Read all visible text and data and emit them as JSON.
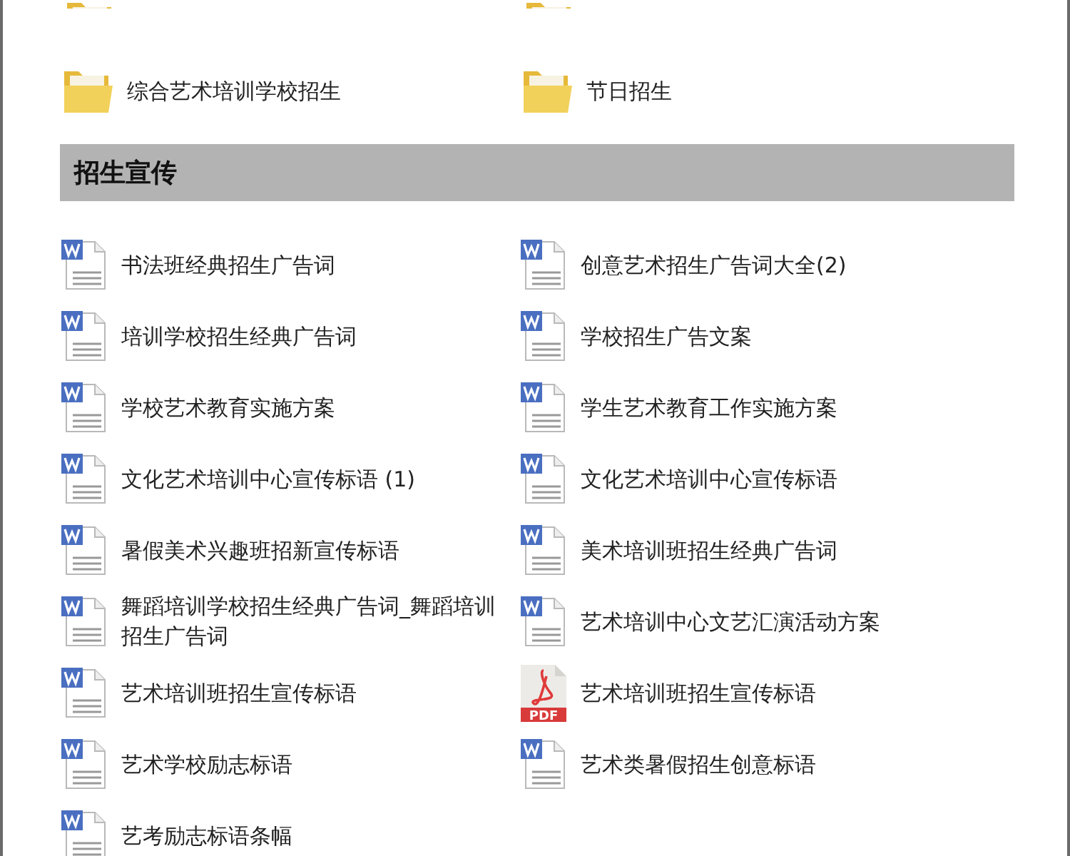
{
  "folders_cut_off": [
    {
      "kind": "folder"
    },
    {
      "kind": "folder"
    }
  ],
  "folders": [
    {
      "kind": "folder",
      "label": "综合艺术培训学校招生"
    },
    {
      "kind": "folder",
      "label": "节日招生"
    }
  ],
  "section": {
    "title": "招生宣传"
  },
  "files": [
    {
      "kind": "word",
      "label": "书法班经典招生广告词"
    },
    {
      "kind": "word",
      "label": "创意艺术招生广告词大全(2)"
    },
    {
      "kind": "word",
      "label": "培训学校招生经典广告词"
    },
    {
      "kind": "word",
      "label": "学校招生广告文案"
    },
    {
      "kind": "word",
      "label": "学校艺术教育实施方案"
    },
    {
      "kind": "word",
      "label": "学生艺术教育工作实施方案"
    },
    {
      "kind": "word",
      "label": "文化艺术培训中心宣传标语 (1)"
    },
    {
      "kind": "word",
      "label": "文化艺术培训中心宣传标语"
    },
    {
      "kind": "word",
      "label": "暑假美术兴趣班招新宣传标语"
    },
    {
      "kind": "word",
      "label": "美术培训班招生经典广告词"
    },
    {
      "kind": "word",
      "label": "舞蹈培训学校招生经典广告词_舞蹈培训招生广告词"
    },
    {
      "kind": "word",
      "label": "艺术培训中心文艺汇演活动方案"
    },
    {
      "kind": "word",
      "label": "艺术培训班招生宣传标语"
    },
    {
      "kind": "pdf",
      "label": "艺术培训班招生宣传标语",
      "badge": "PDF"
    },
    {
      "kind": "word",
      "label": "艺术学校励志标语"
    },
    {
      "kind": "word",
      "label": "艺术类暑假招生创意标语"
    },
    {
      "kind": "word",
      "label": "艺考励志标语条幅"
    }
  ]
}
